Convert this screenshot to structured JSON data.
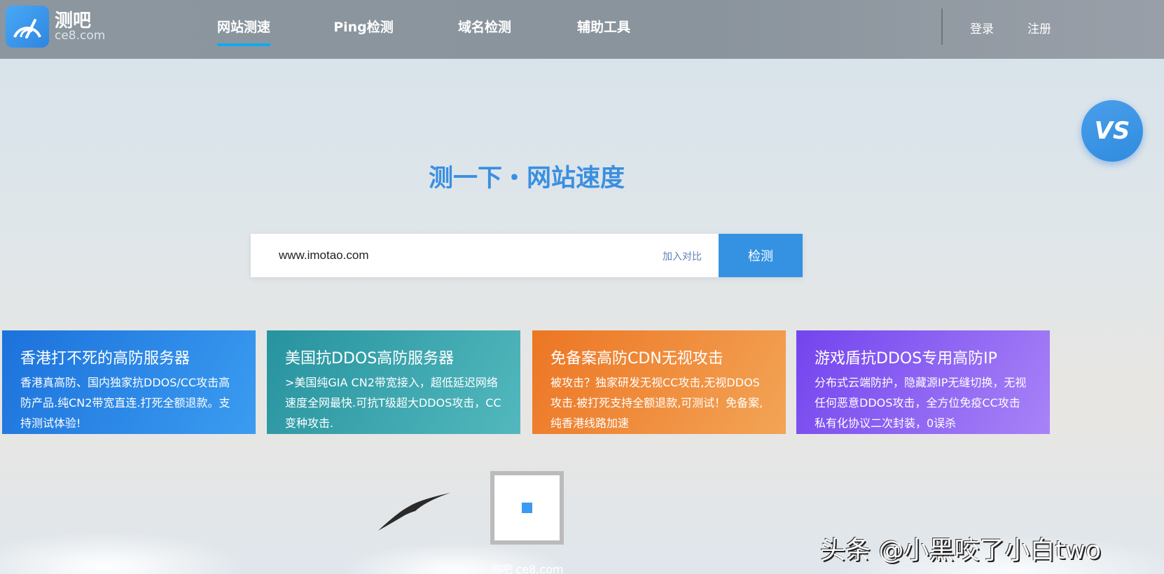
{
  "header": {
    "logo_cn": "测吧",
    "logo_en": "ce8.com",
    "nav": [
      {
        "label": "网站测速",
        "active": true
      },
      {
        "label": "Ping检测"
      },
      {
        "label": "域名检测"
      },
      {
        "label": "辅助工具"
      }
    ],
    "login": "登录",
    "register": "注册"
  },
  "vs_button": "VS",
  "main": {
    "title": "测一下・网站速度",
    "search_value": "www.imotao.com",
    "compare_label": "加入对比",
    "check_button": "检测"
  },
  "cards": [
    {
      "title": "香港打不死的高防服务器",
      "desc": "香港真高防、国内独家抗DDOS/CC攻击高防产品.纯CN2带宽直连.打死全额退款。支持测试体验!"
    },
    {
      "title": "美国抗DDOS高防服务器",
      "desc": ">美国纯GIA CN2带宽接入，超低延迟网络速度全网最快.可抗T级超大DDOS攻击，CC变种攻击."
    },
    {
      "title": "免备案高防CDN无视攻击",
      "desc": "被攻击？独家研发无视CC攻击,无视DDOS攻击.被打死支持全额退款,可测试！免备案,纯香港线路加速"
    },
    {
      "title": "游戏盾抗DDOS专用高防IP",
      "desc": "分布式云端防护，隐藏源IP无缝切换，无视任何恶意DDOS攻击，全方位免疫CC攻击 私有化协议二次封装，0误杀"
    }
  ],
  "footer": {
    "qr_caption": "测吧 ce8.com"
  },
  "watermark": "头条 @小黑咬了小白two"
}
